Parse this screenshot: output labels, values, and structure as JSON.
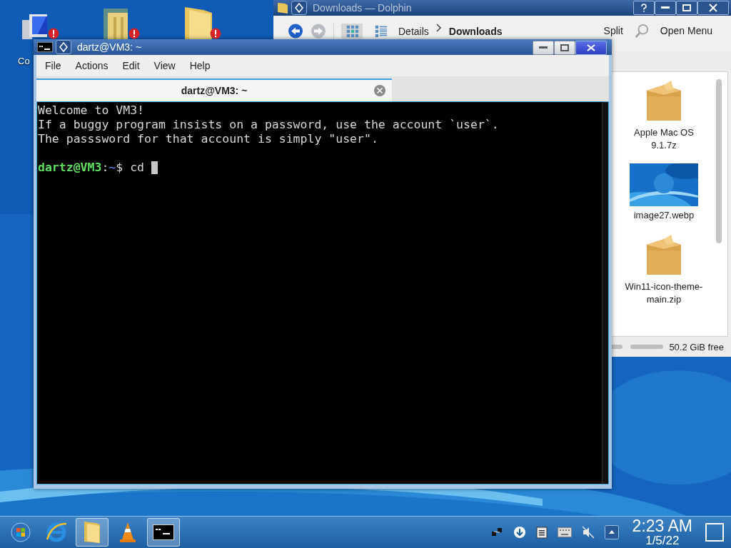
{
  "desktop_icons": [
    {
      "kind": "computer",
      "label": "Co"
    },
    {
      "kind": "library"
    },
    {
      "kind": "folder"
    }
  ],
  "dolphin": {
    "title": "Downloads — Dolphin",
    "views": [
      {
        "kind": "icons",
        "selected": true
      },
      {
        "kind": "details",
        "selected": false
      }
    ],
    "breadcrumb": [
      "Details",
      "Downloads"
    ],
    "split": "Split",
    "menu": "Open Menu",
    "files": [
      {
        "kind": "archive",
        "name": "Apple Mac OS 9.1.7z"
      },
      {
        "name": "image27.webp"
      },
      {
        "kind": "archive",
        "name": "Win11-icon-theme-main.zip"
      }
    ],
    "zoom_slider": {
      "level": 1
    },
    "free_space": "50.2 GiB free"
  },
  "terminal": {
    "title": "dartz@VM3: ~",
    "menu": [
      "File",
      "Actions",
      "Edit",
      "View",
      "Help"
    ],
    "tabs": [
      {
        "label": "dartz@VM3: ~",
        "selected": true
      }
    ],
    "lines": [
      "Welcome to VM3!",
      "If a buggy program insists on a password, use the account `user`.",
      "The passsword for that account is simply \"user\"."
    ],
    "prompt": {
      "user": "dartz@VM3",
      "separator": ":",
      "path": "~",
      "symbol": "$",
      "command": "cd"
    }
  },
  "taskbar": {
    "items": [
      {
        "kind": "start",
        "selected": false
      },
      {
        "kind": "browser",
        "selected": false
      },
      {
        "kind": "folder",
        "selected": true
      },
      {
        "kind": "cone",
        "selected": false
      },
      {
        "kind": "terminal",
        "selected": true
      }
    ],
    "tray": [
      {
        "kind": "network"
      },
      {
        "kind": "download"
      },
      {
        "kind": "clipboard"
      },
      {
        "kind": "keyboard"
      },
      {
        "kind": "muted"
      },
      {
        "kind": "expand"
      }
    ],
    "time": "2:23 AM",
    "date": "1/5/22"
  }
}
